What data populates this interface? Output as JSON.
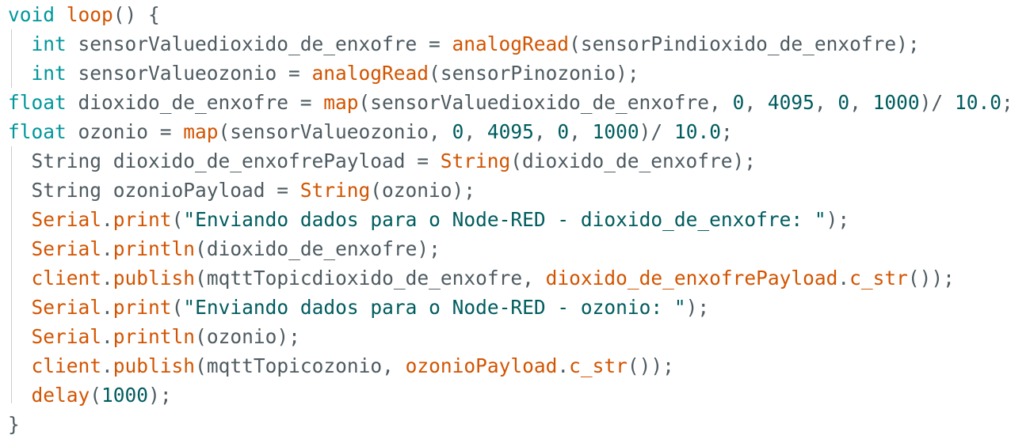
{
  "theme": {
    "keyword_color": "#00979c",
    "function_color": "#d35400",
    "text_color": "#4e5b61",
    "number_color": "#005c5f",
    "string_color": "#005c5f",
    "guide_color": "#c9ced1"
  },
  "code": {
    "lines": [
      [
        [
          "kw",
          "void"
        ],
        [
          "t",
          " "
        ],
        [
          "fn",
          "loop"
        ],
        [
          "t",
          "() {"
        ]
      ],
      [
        [
          "t",
          "  "
        ],
        [
          "kw",
          "int"
        ],
        [
          "t",
          " sensorValuedioxido_de_enxofre = "
        ],
        [
          "fn",
          "analogRead"
        ],
        [
          "t",
          "(sensorPindioxido_de_enxofre);"
        ]
      ],
      [
        [
          "t",
          "  "
        ],
        [
          "kw",
          "int"
        ],
        [
          "t",
          " sensorValueozonio = "
        ],
        [
          "fn",
          "analogRead"
        ],
        [
          "t",
          "(sensorPinozonio);"
        ]
      ],
      [
        [
          "kw",
          "float"
        ],
        [
          "t",
          " dioxido_de_enxofre = "
        ],
        [
          "fn",
          "map"
        ],
        [
          "t",
          "(sensorValuedioxido_de_enxofre, "
        ],
        [
          "num",
          "0"
        ],
        [
          "t",
          ", "
        ],
        [
          "num",
          "4095"
        ],
        [
          "t",
          ", "
        ],
        [
          "num",
          "0"
        ],
        [
          "t",
          ", "
        ],
        [
          "num",
          "1000"
        ],
        [
          "t",
          ")/ "
        ],
        [
          "num",
          "10.0"
        ],
        [
          "t",
          ";"
        ]
      ],
      [
        [
          "kw",
          "float"
        ],
        [
          "t",
          " ozonio = "
        ],
        [
          "fn",
          "map"
        ],
        [
          "t",
          "(sensorValueozonio, "
        ],
        [
          "num",
          "0"
        ],
        [
          "t",
          ", "
        ],
        [
          "num",
          "4095"
        ],
        [
          "t",
          ", "
        ],
        [
          "num",
          "0"
        ],
        [
          "t",
          ", "
        ],
        [
          "num",
          "1000"
        ],
        [
          "t",
          ")/ "
        ],
        [
          "num",
          "10.0"
        ],
        [
          "t",
          ";"
        ]
      ],
      [
        [
          "t",
          "  String dioxido_de_enxofrePayload = "
        ],
        [
          "fn",
          "String"
        ],
        [
          "t",
          "(dioxido_de_enxofre);"
        ]
      ],
      [
        [
          "t",
          "  String ozonioPayload = "
        ],
        [
          "fn",
          "String"
        ],
        [
          "t",
          "(ozonio);"
        ]
      ],
      [
        [
          "t",
          "  "
        ],
        [
          "fn",
          "Serial"
        ],
        [
          "t",
          "."
        ],
        [
          "fn",
          "print"
        ],
        [
          "t",
          "("
        ],
        [
          "str",
          "\"Enviando dados para o Node-RED - dioxido_de_enxofre: \""
        ],
        [
          "t",
          ");"
        ]
      ],
      [
        [
          "t",
          "  "
        ],
        [
          "fn",
          "Serial"
        ],
        [
          "t",
          "."
        ],
        [
          "fn",
          "println"
        ],
        [
          "t",
          "(dioxido_de_enxofre);"
        ]
      ],
      [
        [
          "t",
          "  "
        ],
        [
          "fn",
          "client"
        ],
        [
          "t",
          "."
        ],
        [
          "fn",
          "publish"
        ],
        [
          "t",
          "(mqttTopicdioxido_de_enxofre, "
        ],
        [
          "fn",
          "dioxido_de_enxofrePayload"
        ],
        [
          "t",
          "."
        ],
        [
          "fn",
          "c_str"
        ],
        [
          "t",
          "());"
        ]
      ],
      [
        [
          "t",
          "  "
        ],
        [
          "fn",
          "Serial"
        ],
        [
          "t",
          "."
        ],
        [
          "fn",
          "print"
        ],
        [
          "t",
          "("
        ],
        [
          "str",
          "\"Enviando dados para o Node-RED - ozonio: \""
        ],
        [
          "t",
          ");"
        ]
      ],
      [
        [
          "t",
          "  "
        ],
        [
          "fn",
          "Serial"
        ],
        [
          "t",
          "."
        ],
        [
          "fn",
          "println"
        ],
        [
          "t",
          "(ozonio);"
        ]
      ],
      [
        [
          "t",
          "  "
        ],
        [
          "fn",
          "client"
        ],
        [
          "t",
          "."
        ],
        [
          "fn",
          "publish"
        ],
        [
          "t",
          "(mqttTopicozonio, "
        ],
        [
          "fn",
          "ozonioPayload"
        ],
        [
          "t",
          "."
        ],
        [
          "fn",
          "c_str"
        ],
        [
          "t",
          "());"
        ]
      ],
      [
        [
          "t",
          "  "
        ],
        [
          "fn",
          "delay"
        ],
        [
          "t",
          "("
        ],
        [
          "num",
          "1000"
        ],
        [
          "t",
          ");"
        ]
      ],
      [
        [
          "t",
          "}"
        ]
      ]
    ]
  }
}
